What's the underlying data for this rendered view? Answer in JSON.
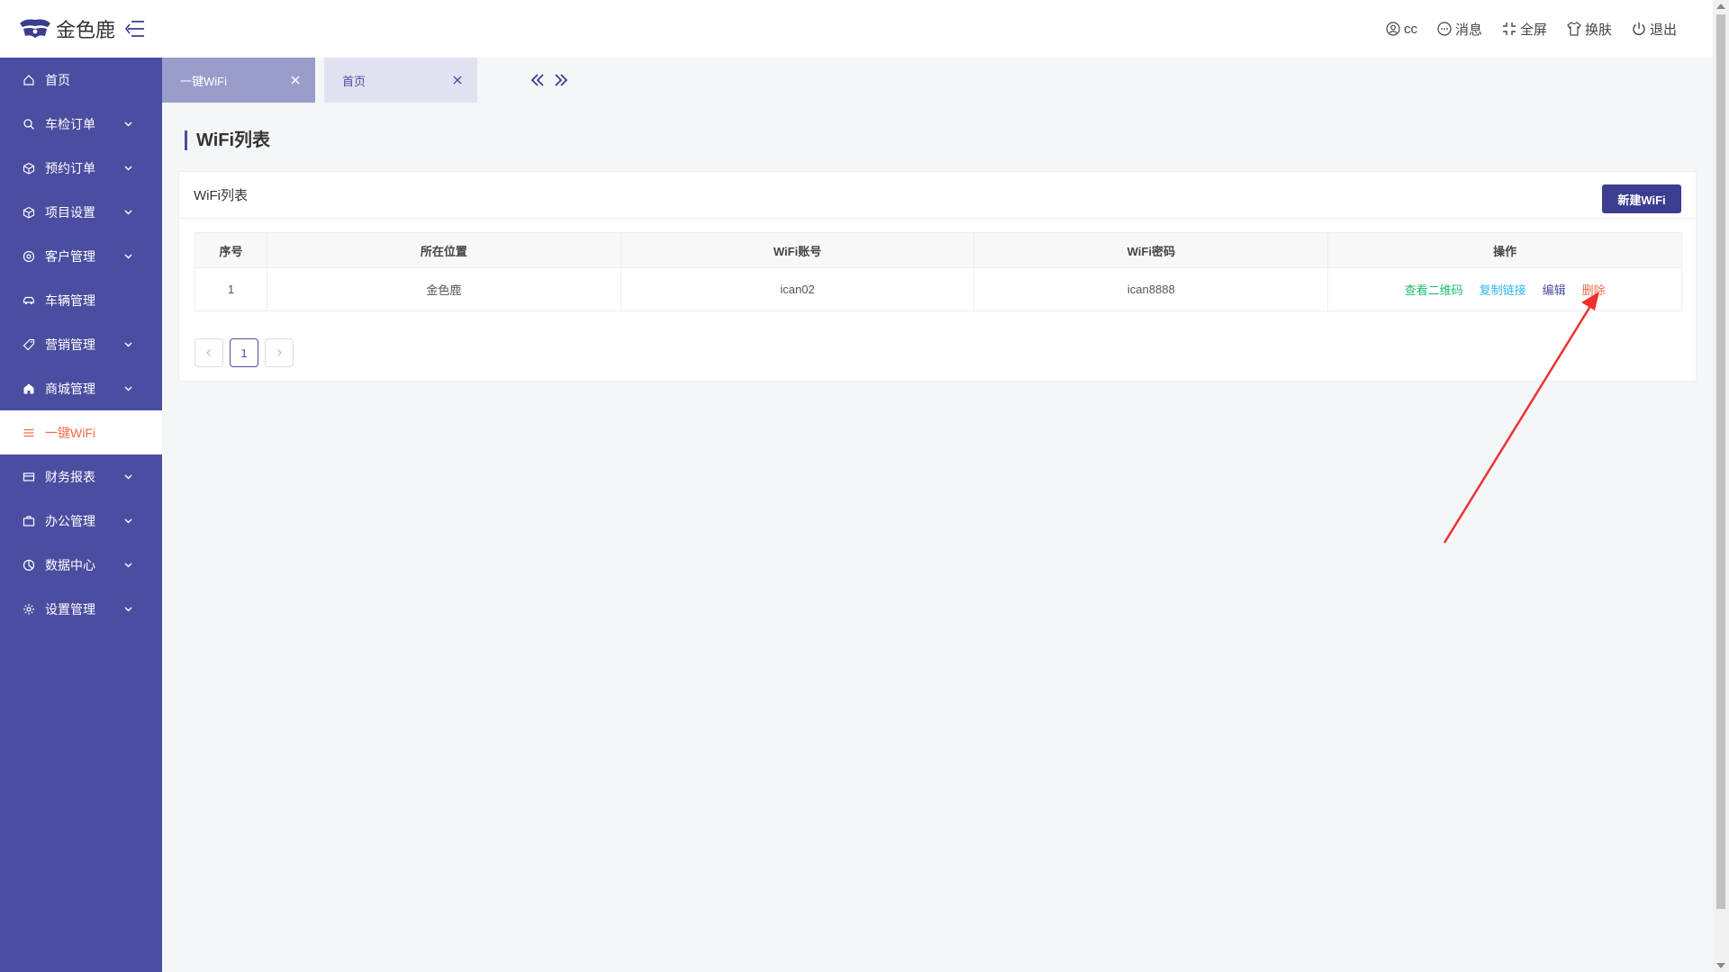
{
  "header": {
    "logo_text": "金色鹿",
    "user": "cc",
    "messages": "消息",
    "fullscreen": "全屏",
    "skin": "换肤",
    "logout": "退出"
  },
  "sidebar": {
    "items": [
      {
        "label": "首页",
        "icon": "home-icon"
      },
      {
        "label": "车检订单",
        "icon": "search-icon"
      },
      {
        "label": "预约订单",
        "icon": "box-icon"
      },
      {
        "label": "项目设置",
        "icon": "box-icon"
      },
      {
        "label": "客户管理",
        "icon": "user-circle-icon"
      },
      {
        "label": "车辆管理",
        "icon": "car-icon"
      },
      {
        "label": "营销管理",
        "icon": "tag-icon"
      },
      {
        "label": "商城管理",
        "icon": "shop-icon"
      },
      {
        "label": "一键WiFi",
        "icon": "list-icon",
        "active": true
      },
      {
        "label": "财务报表",
        "icon": "card-icon"
      },
      {
        "label": "办公管理",
        "icon": "briefcase-icon"
      },
      {
        "label": "数据中心",
        "icon": "pie-icon"
      },
      {
        "label": "设置管理",
        "icon": "gear-icon"
      }
    ]
  },
  "tabs": [
    {
      "label": "一键WiFi",
      "active": true
    },
    {
      "label": "首页",
      "active": false
    }
  ],
  "page": {
    "title": "WiFi列表"
  },
  "card": {
    "title": "WiFi列表",
    "new_button": "新建WiFi"
  },
  "table": {
    "headers": [
      "序号",
      "所在位置",
      "WiFi账号",
      "WiFi密码",
      "操作"
    ],
    "rows": [
      {
        "index": "1",
        "location": "金色鹿",
        "account": "ican02",
        "password": "ican8888",
        "actions": {
          "qr": "查看二维码",
          "copy": "复制链接",
          "edit": "编辑",
          "delete": "删除"
        }
      }
    ]
  },
  "pagination": {
    "current": "1"
  },
  "colors": {
    "sidebar": "#4a4da0",
    "primary_button": "#3b3d8f",
    "active_menu_text": "#f26b4b",
    "annotation_arrow": "#f03030"
  }
}
